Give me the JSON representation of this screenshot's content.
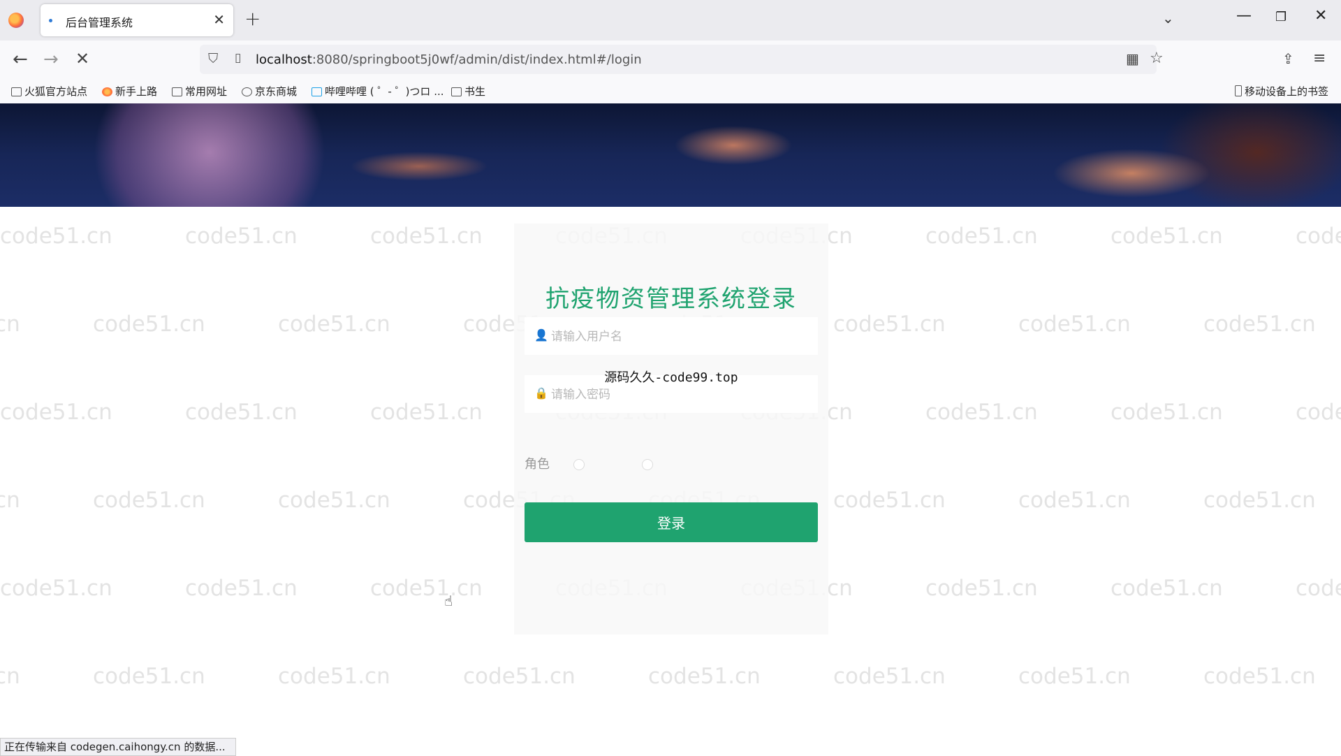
{
  "browser": {
    "tab_title": "后台管理系统",
    "url_host": "localhost",
    "url_rest": ":8080/springboot5j0wf/admin/dist/index.html#/login"
  },
  "bookmarks": [
    {
      "label": "火狐官方站点",
      "icon": "folder-icon"
    },
    {
      "label": "新手上路",
      "icon": "firefox-icon"
    },
    {
      "label": "常用网址",
      "icon": "folder-icon"
    },
    {
      "label": "京东商城",
      "icon": "globe-icon"
    },
    {
      "label": "哔哩哔哩 ( ゜- ゜)つロ ...",
      "icon": "bilibili-icon"
    },
    {
      "label": "书生",
      "icon": "folder-icon"
    }
  ],
  "mobile_bookmarks": "移动设备上的书签",
  "watermark": "code51.cn",
  "login": {
    "title": "抗疫物资管理系统登录",
    "username_placeholder": "请输入用户名",
    "password_placeholder": "请输入密码",
    "role_label": "角色",
    "button_label": "登录"
  },
  "overlay_text": "源码久久-code99.top",
  "status_text": "正在传输来自 codegen.caihongy.cn 的数据..."
}
